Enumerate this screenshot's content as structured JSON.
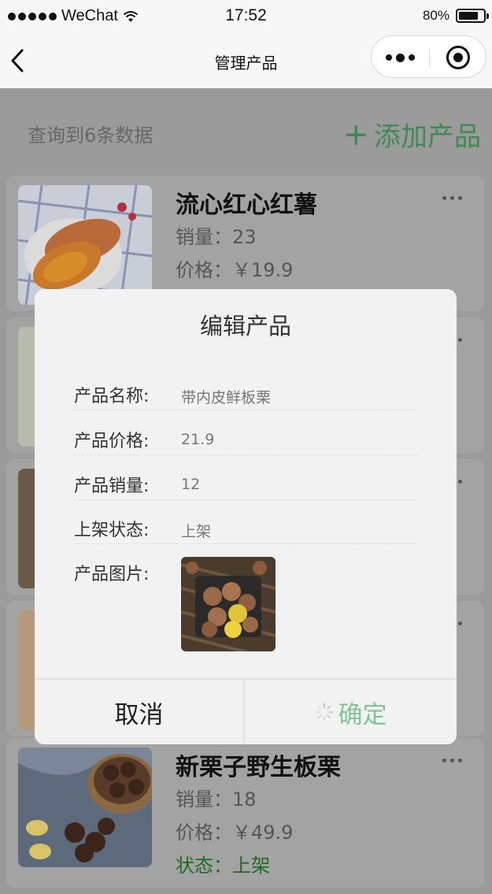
{
  "status_bar": {
    "carrier": "WeChat",
    "time": "17:52",
    "battery": "80%",
    "battery_level": 0.8
  },
  "nav": {
    "title": "管理产品",
    "back_icon": "chevron-left-icon",
    "more_icon": "more-dots-icon",
    "close_icon": "target-icon"
  },
  "list_header": {
    "count_text": "查询到6条数据",
    "add_label": "添加产品",
    "add_icon": "plus-icon"
  },
  "products": [
    {
      "name": "流心红心红薯",
      "sales": "销量：23",
      "price": "价格：￥19.9"
    },
    {
      "name": "新栗子野生板栗",
      "sales": "销量：18",
      "price": "价格：￥49.9",
      "state": "状态：上架"
    }
  ],
  "modal": {
    "title": "编辑产品",
    "fields": [
      {
        "label": "产品名称:",
        "value": "带内皮鲜板栗"
      },
      {
        "label": "产品价格:",
        "value": "21.9"
      },
      {
        "label": "产品销量:",
        "value": "12"
      },
      {
        "label": "上架状态:",
        "value": "上架"
      }
    ],
    "image_label": "产品图片:",
    "cancel": "取消",
    "confirm": "确定"
  },
  "colors": {
    "accent_green": "#3f8a54",
    "confirm_green": "#7fc397",
    "state_green": "#1f6a1f"
  }
}
